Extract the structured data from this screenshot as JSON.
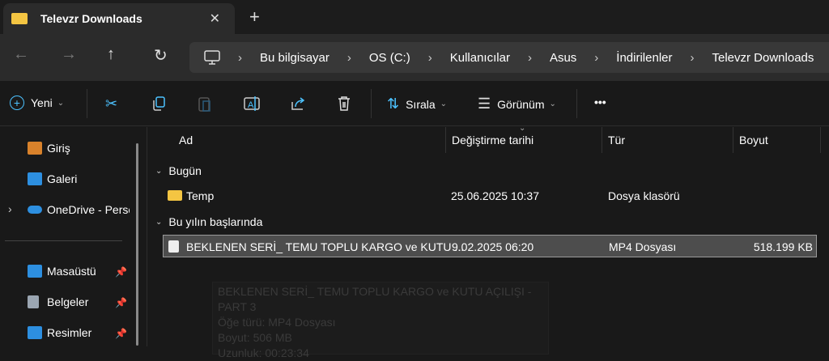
{
  "tab": {
    "title": "Televzr Downloads",
    "close_icon": "close-icon",
    "new_tab_icon": "plus-icon"
  },
  "nav": {
    "back": "←",
    "forward": "→",
    "up": "↑",
    "refresh": "↻"
  },
  "breadcrumb": [
    "Bu bilgisayar",
    "OS (C:)",
    "Kullanıcılar",
    "Asus",
    "İndirilenler",
    "Televzr Downloads"
  ],
  "toolbar": {
    "new_label": "Yeni",
    "sort_label": "Sırala",
    "view_label": "Görünüm",
    "more": "•••"
  },
  "sidebar": {
    "items": [
      {
        "label": "Giriş",
        "icon": "home-icon"
      },
      {
        "label": "Galeri",
        "icon": "gallery-icon"
      },
      {
        "label": "OneDrive - Personal",
        "icon": "cloud-icon"
      },
      {
        "label": "Masaüstü",
        "icon": "desktop-icon",
        "pinned": true
      },
      {
        "label": "Belgeler",
        "icon": "documents-icon",
        "pinned": true
      },
      {
        "label": "Resimler",
        "icon": "pictures-icon",
        "pinned": true
      }
    ]
  },
  "columns": [
    "Ad",
    "Değiştirme tarihi",
    "Tür",
    "Boyut"
  ],
  "groups": [
    {
      "label": "Bugün",
      "rows": [
        {
          "name": "Temp",
          "date": "25.06.2025 10:37",
          "type": "Dosya klasörü",
          "size": ""
        }
      ]
    },
    {
      "label": "Bu yılın başlarında",
      "rows": [
        {
          "name": "BEKLENEN SERİ_ TEMU TOPLU KARGO ve KUTU ...",
          "date": "9.02.2025 06:20",
          "type": "MP4 Dosyası",
          "size": "518.199 KB"
        }
      ]
    }
  ],
  "tooltip": {
    "lines": [
      "BEKLENEN SERİ_ TEMU TOPLU KARGO ve KUTU AÇILIŞI - PART 3",
      "Öğe türü: MP4 Dosyası",
      "Boyut: 506 MB",
      "Uzunluk: 00:23:34"
    ]
  },
  "colors": {
    "accent": "#4cc2ff",
    "folder": "#f4c542",
    "selection": "#4d4d4d"
  }
}
